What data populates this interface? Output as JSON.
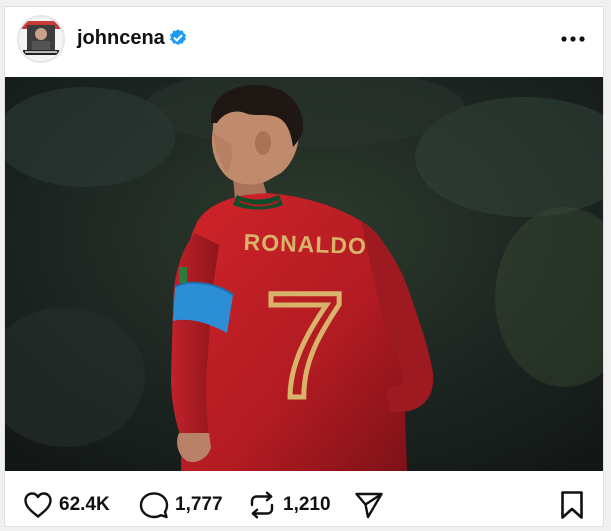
{
  "post": {
    "username": "johncena",
    "verified": true,
    "photo_jersey_name": "RONALDO",
    "photo_jersey_number": "7",
    "likes": "62.4K",
    "comments": "1,777",
    "reposts": "1,210"
  },
  "icons": {
    "avatar": "profile-photo",
    "verified": "verified-badge-icon",
    "more": "more-options-icon",
    "like": "heart-icon",
    "comment": "comment-bubble-icon",
    "repost": "repost-arrows-icon",
    "share": "paper-plane-icon",
    "save": "bookmark-icon"
  },
  "colors": {
    "verified_blue": "#1d9bf0",
    "jersey_red": "#b81b22",
    "armband_blue": "#2c8fd6",
    "jersey_gold": "#d9b36a"
  }
}
